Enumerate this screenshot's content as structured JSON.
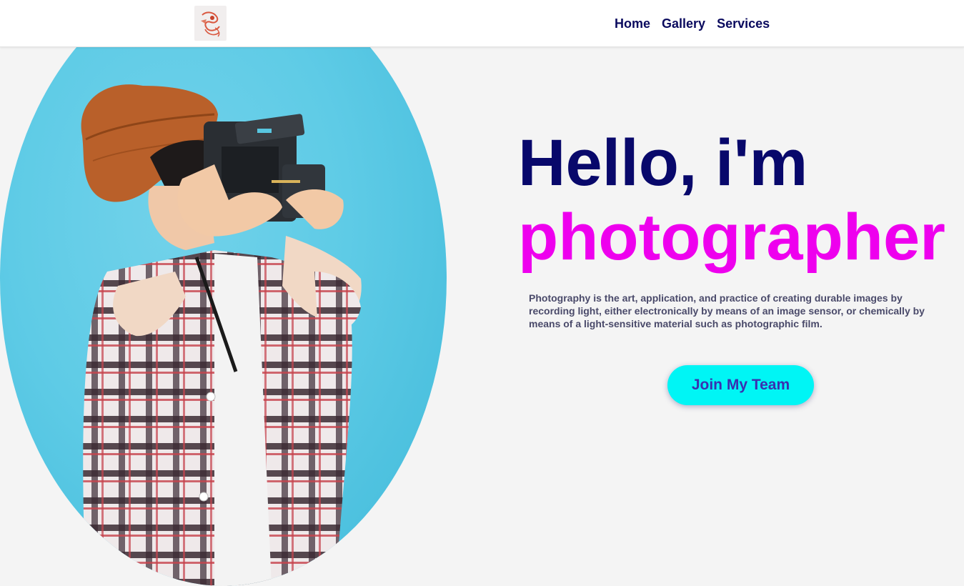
{
  "header": {
    "logo_icon": "camera-logo-icon",
    "nav": [
      {
        "label": "Home"
      },
      {
        "label": "Gallery"
      },
      {
        "label": "Services"
      }
    ]
  },
  "hero": {
    "title_line1": "Hello, i'm",
    "title_line2": "photographer",
    "description": "Photography is the art, application, and practice of creating durable images by recording light, either electronically by means of an image sensor, or chemically by means of a light-sensitive material such as photographic film.",
    "cta_label": "Join My Team",
    "image_icon": "photographer-photo",
    "colors": {
      "title_primary": "#08086b",
      "title_accent": "#ee00ee",
      "cta_background": "#00f5f5",
      "cta_text": "#3a2fb0",
      "oval_background": "#5ecbe6"
    }
  }
}
